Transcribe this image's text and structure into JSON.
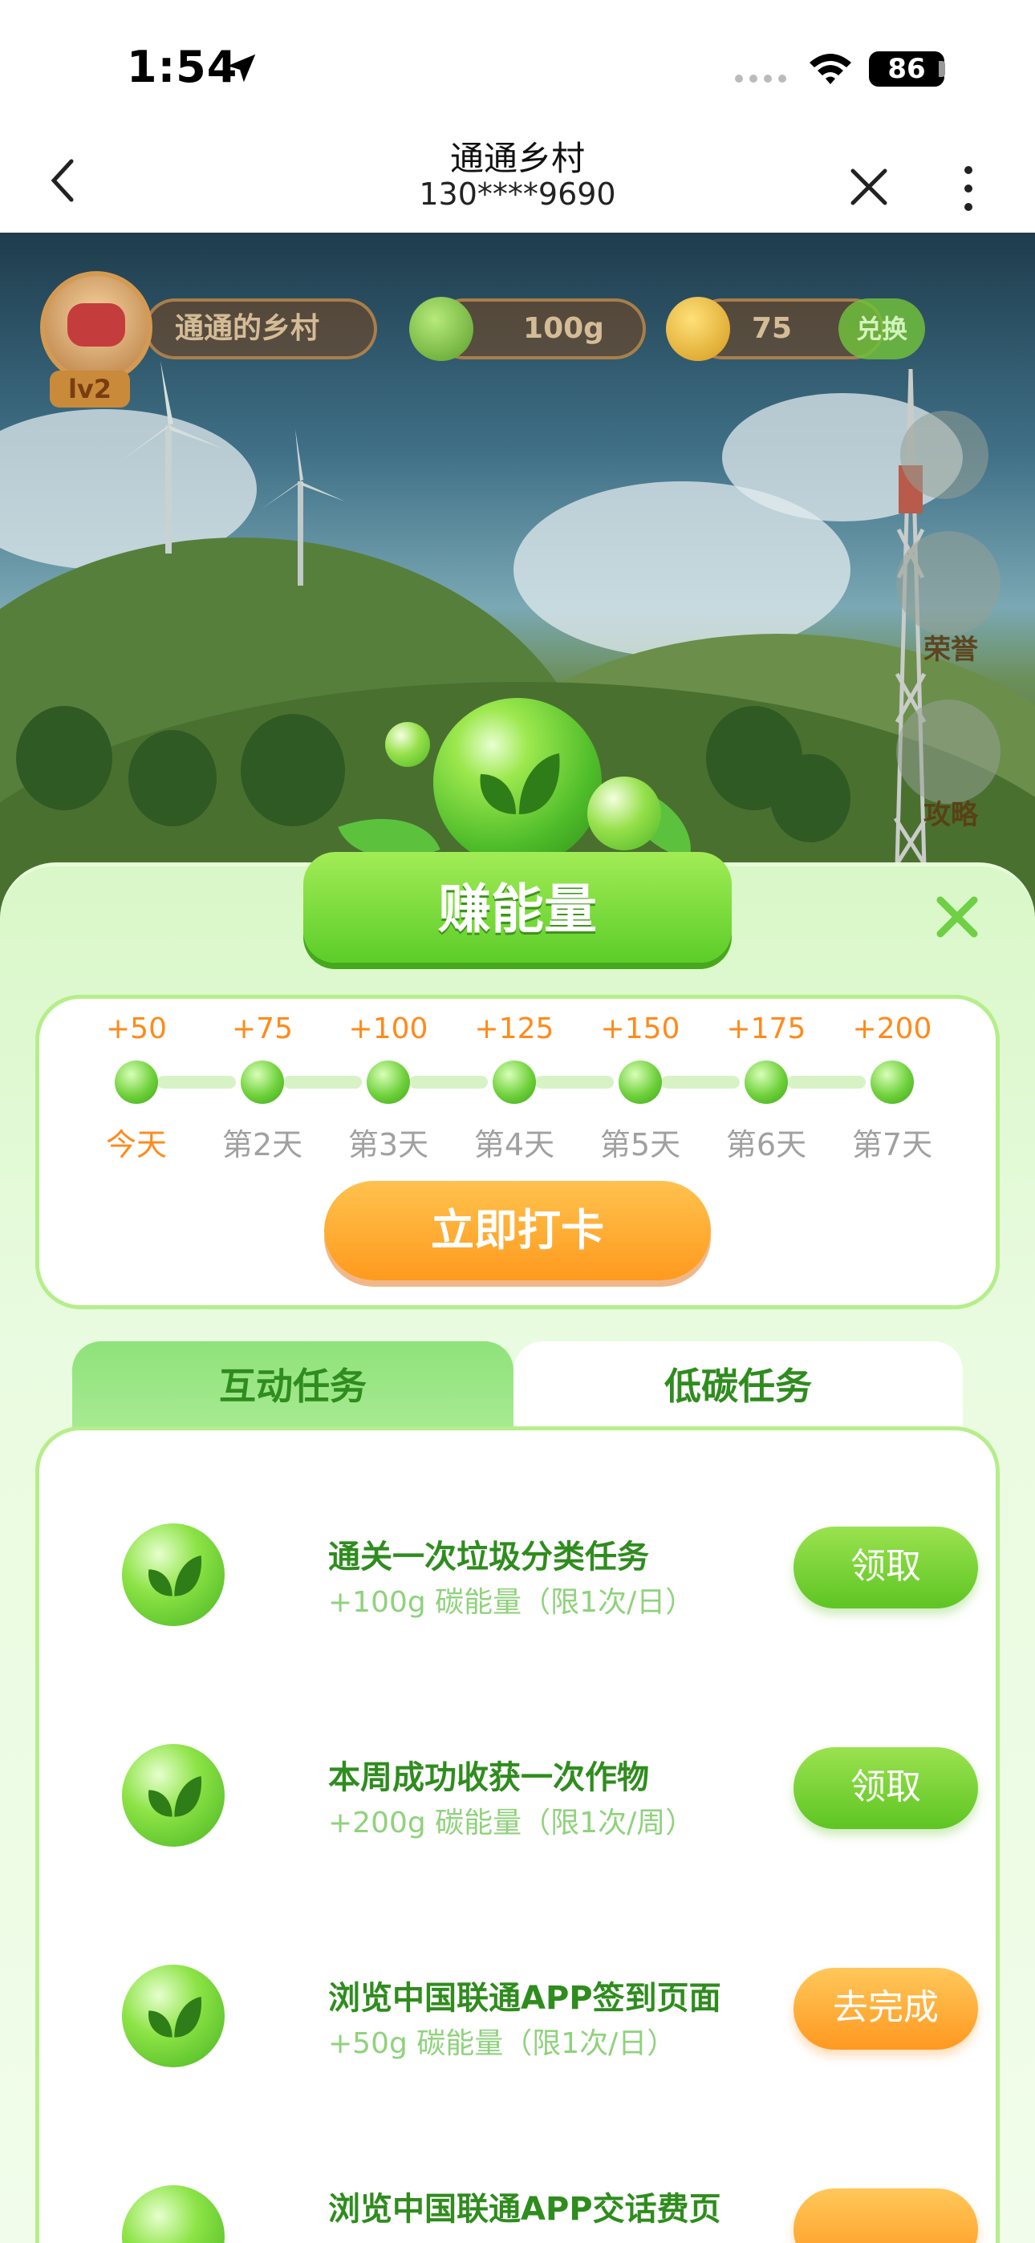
{
  "status_bar": {
    "time": "1:54",
    "battery": "86"
  },
  "nav": {
    "title": "通通乡村",
    "subtitle": "130****9690"
  },
  "hud": {
    "village_name": "通通的乡村",
    "level": "lv2",
    "energy": "100g",
    "stars": "75",
    "exchange": "兑换"
  },
  "side_buttons": {
    "honor": "荣誉",
    "guide": "攻略"
  },
  "panel": {
    "title": "赚能量",
    "checkin": {
      "days": [
        {
          "reward": "+50",
          "label": "今天"
        },
        {
          "reward": "+75",
          "label": "第2天"
        },
        {
          "reward": "+100",
          "label": "第3天"
        },
        {
          "reward": "+125",
          "label": "第4天"
        },
        {
          "reward": "+150",
          "label": "第5天"
        },
        {
          "reward": "+175",
          "label": "第6天"
        },
        {
          "reward": "+200",
          "label": "第7天"
        }
      ],
      "button": "立即打卡"
    },
    "tabs": {
      "interactive": "互动任务",
      "low_carbon": "低碳任务"
    },
    "tasks": [
      {
        "title": "通关一次垃圾分类任务",
        "sub": "+100g 碳能量（限1次/日）",
        "button": "领取"
      },
      {
        "title": "本周成功收获一次作物",
        "sub": "+200g 碳能量（限1次/周）",
        "button": "领取"
      },
      {
        "title": "浏览中国联通APP签到页面",
        "sub": "+50g 碳能量（限1次/日）",
        "button": "去完成"
      },
      {
        "title": "浏览中国联通APP交话费页",
        "sub": "",
        "button": ""
      }
    ]
  },
  "colors": {
    "accent_green": "#5ec523",
    "accent_orange": "#ff9820",
    "task_text": "#2f8c1e"
  }
}
